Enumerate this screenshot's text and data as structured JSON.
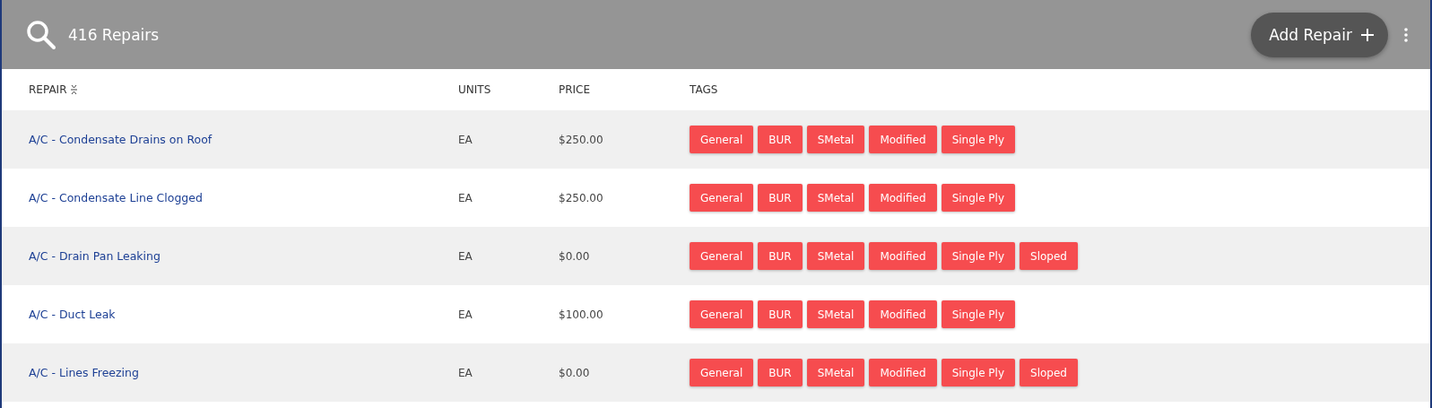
{
  "header": {
    "title": "416 Repairs",
    "add_button": "Add Repair"
  },
  "table": {
    "columns": [
      "REPAIR",
      "UNITS",
      "PRICE",
      "TAGS"
    ],
    "rows": [
      {
        "repair": "A/C - Condensate Drains on Roof",
        "units": "EA",
        "price": "$250.00",
        "tags": [
          "General",
          "BUR",
          "SMetal",
          "Modified",
          "Single Ply"
        ]
      },
      {
        "repair": "A/C - Condensate Line Clogged",
        "units": "EA",
        "price": "$250.00",
        "tags": [
          "General",
          "BUR",
          "SMetal",
          "Modified",
          "Single Ply"
        ]
      },
      {
        "repair": "A/C - Drain Pan Leaking",
        "units": "EA",
        "price": "$0.00",
        "tags": [
          "General",
          "BUR",
          "SMetal",
          "Modified",
          "Single Ply",
          "Sloped"
        ]
      },
      {
        "repair": "A/C - Duct Leak",
        "units": "EA",
        "price": "$100.00",
        "tags": [
          "General",
          "BUR",
          "SMetal",
          "Modified",
          "Single Ply"
        ]
      },
      {
        "repair": "A/C - Lines Freezing",
        "units": "EA",
        "price": "$0.00",
        "tags": [
          "General",
          "BUR",
          "SMetal",
          "Modified",
          "Single Ply",
          "Sloped"
        ]
      }
    ]
  }
}
